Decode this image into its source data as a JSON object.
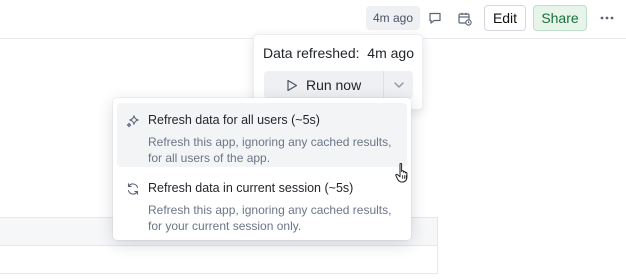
{
  "header": {
    "last_refreshed": "4m ago",
    "edit_label": "Edit",
    "share_label": "Share"
  },
  "refresh_panel": {
    "title_prefix": "Data refreshed:",
    "title_time": "4m ago",
    "run_label": "Run now"
  },
  "refresh_menu": {
    "items": [
      {
        "label": "Refresh data for all users (~5s)",
        "description": "Refresh this app, ignoring any cached results, for all users of the app.",
        "icon": "sparkle-icon"
      },
      {
        "label": "Refresh data in current session (~5s)",
        "description": "Refresh this app, ignoring any cached results, for your current session only.",
        "icon": "refresh-icon"
      }
    ]
  },
  "colors": {
    "share_bg": "#e7f4ea",
    "share_text": "#18703a",
    "pill_bg": "#eef0f3",
    "muted_text": "#6b7686"
  }
}
